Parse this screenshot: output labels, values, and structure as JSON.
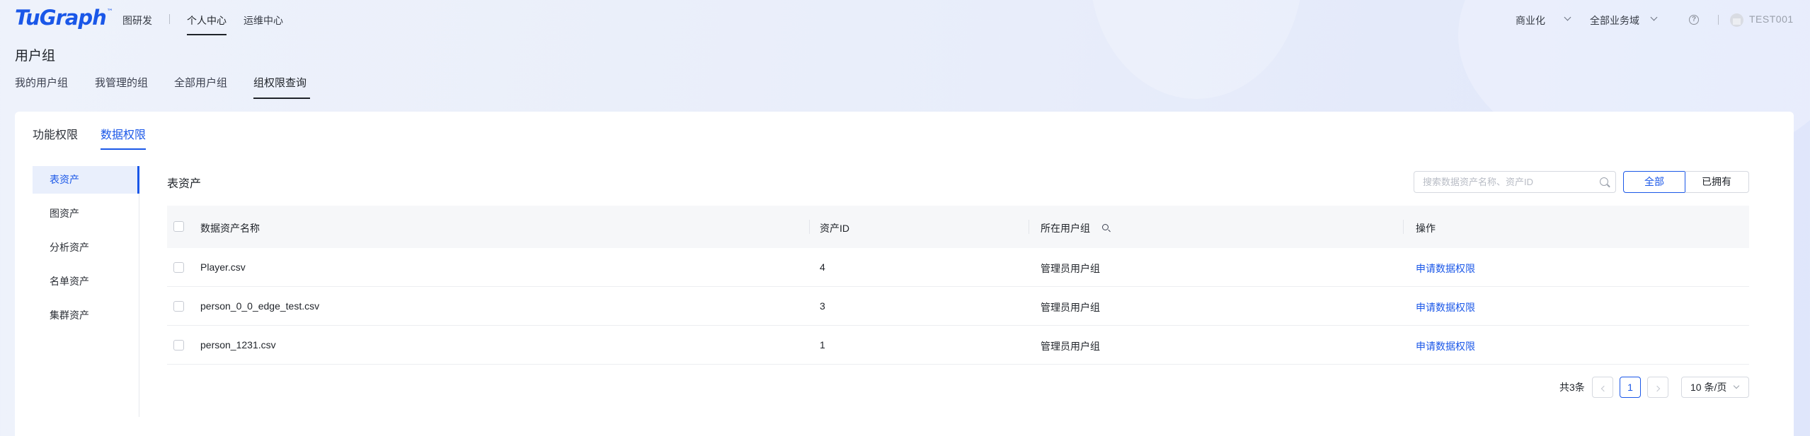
{
  "topbar": {
    "logo": "TuGraph",
    "logo_mark": "™",
    "nav": [
      "图研发",
      "个人中心",
      "运维中心"
    ],
    "commercial": "商业化",
    "business_domain": "全部业务域",
    "username": "TEST001"
  },
  "page": {
    "title": "用户组",
    "tabs": [
      "我的用户组",
      "我管理的组",
      "全部用户组",
      "组权限查询"
    ]
  },
  "card": {
    "tabs": [
      "功能权限",
      "数据权限"
    ],
    "sidenav": [
      "表资产",
      "图资产",
      "分析资产",
      "名单资产",
      "集群资产"
    ],
    "section_title": "表资产",
    "search_placeholder": "搜索数据资产名称、资产ID",
    "filter": [
      "全部",
      "已拥有"
    ],
    "table": {
      "columns": [
        "数据资产名称",
        "资产ID",
        "所在用户组",
        "操作"
      ],
      "rows": [
        {
          "name": "Player.csv",
          "id": "4",
          "group": "管理员用户组",
          "action": "申请数据权限"
        },
        {
          "name": "person_0_0_edge_test.csv",
          "id": "3",
          "group": "管理员用户组",
          "action": "申请数据权限"
        },
        {
          "name": "person_1231.csv",
          "id": "1",
          "group": "管理员用户组",
          "action": "申请数据权限"
        }
      ]
    },
    "pager": {
      "total": "共3条",
      "current_page": "1",
      "page_size": "10 条/页"
    }
  },
  "colors": {
    "accent": "#1a57e8",
    "text": "#1f2329",
    "header_bg": "#f6f7f9"
  }
}
